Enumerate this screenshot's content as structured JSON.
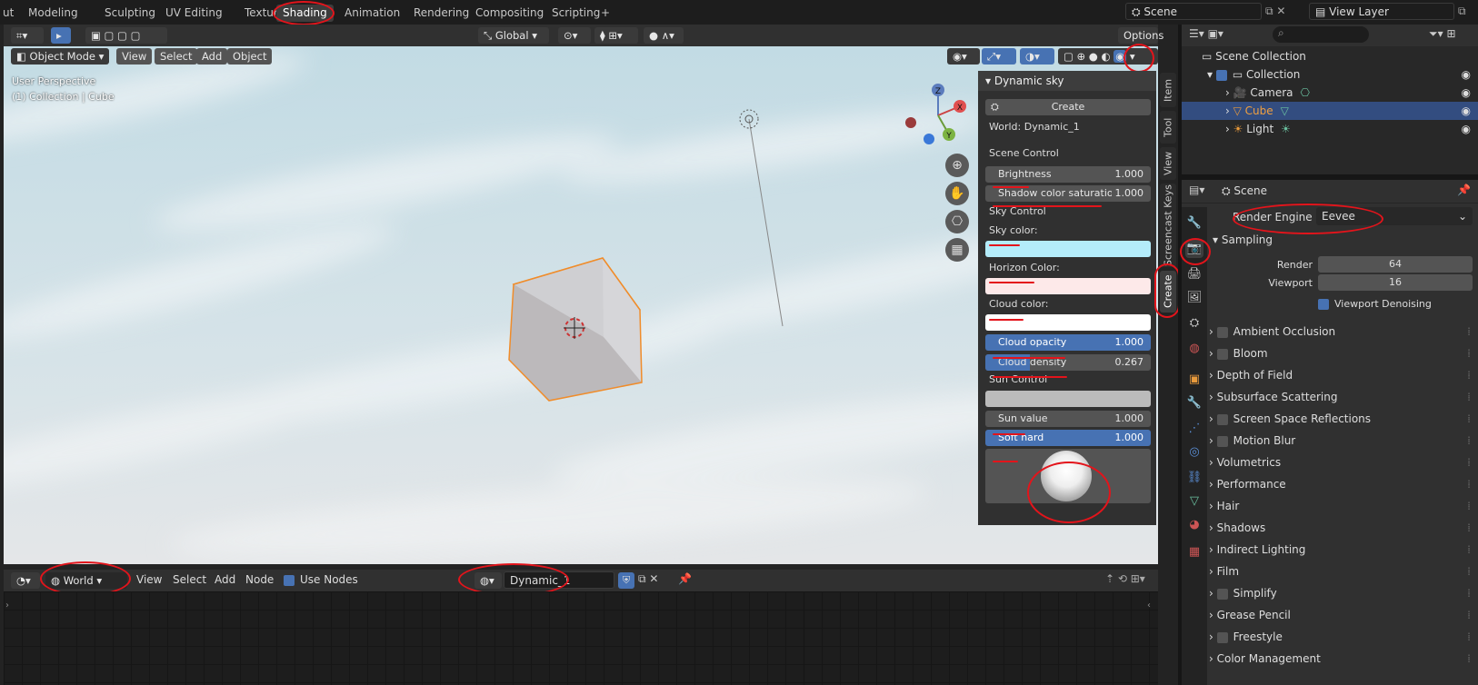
{
  "workspace_tabs": [
    "ut",
    "Modeling",
    "Sculpting",
    "UV Editing",
    "Texture Paint",
    "Shading",
    "Animation",
    "Rendering",
    "Compositing",
    "Scripting",
    "+"
  ],
  "active_tab": "Shading",
  "scene_field": "Scene",
  "view_layer_field": "View Layer",
  "viewport_header": {
    "transform": "Global",
    "options": "Options",
    "mode": "Object Mode",
    "menus": [
      "View",
      "Select",
      "Add",
      "Object"
    ]
  },
  "viewport_info": {
    "line1": "User Perspective",
    "line2": "(1) Collection | Cube"
  },
  "gizmo": {
    "z": "Z",
    "x": "X",
    "y": "Y"
  },
  "npanel": {
    "title": "Dynamic sky",
    "create_button": "Create",
    "world_label": "World: Dynamic_1",
    "scene_control": "Scene Control",
    "brightness": {
      "label": "Brightness",
      "value": "1.000"
    },
    "shadow": {
      "label": "Shadow color saturatio",
      "value": "1.000"
    },
    "sky_control": "Sky Control",
    "sky_color": "Sky color:",
    "horizon_color": "Horizon Color:",
    "cloud_color": "Cloud color:",
    "cloud_opacity": {
      "label": "Cloud opacity",
      "value": "1.000"
    },
    "cloud_density": {
      "label": "Cloud density",
      "value": "0.267"
    },
    "sun_control": "Sun Control",
    "sun_value": {
      "label": "Sun value",
      "value": "1.000"
    },
    "soft_hard": {
      "label": "Soft hard",
      "value": "1.000"
    },
    "sky_swatch": "#b4ecfa",
    "horizon_swatch": "#fde9e9",
    "cloud_swatch": "#ffffff"
  },
  "side_tabs": [
    "Item",
    "Tool",
    "View",
    "Screencast Keys",
    "Create"
  ],
  "node_header": {
    "world": "World",
    "menus": [
      "View",
      "Select",
      "Add",
      "Node"
    ],
    "use_nodes": "Use Nodes",
    "datablock": "Dynamic_1"
  },
  "outliner": {
    "root": "Scene Collection",
    "collection": "Collection",
    "items": [
      "Camera",
      "Cube",
      "Light"
    ]
  },
  "properties": {
    "breadcrumb": "Scene",
    "render_engine_label": "Render Engine",
    "render_engine": "Eevee",
    "sampling": "Sampling",
    "render_label": "Render",
    "render_value": "64",
    "viewport_label": "Viewport",
    "viewport_value": "16",
    "denoise": "Viewport Denoising",
    "sections": [
      {
        "label": "Ambient Occlusion",
        "check": true
      },
      {
        "label": "Bloom",
        "check": true
      },
      {
        "label": "Depth of Field",
        "check": false
      },
      {
        "label": "Subsurface Scattering",
        "check": false
      },
      {
        "label": "Screen Space Reflections",
        "check": true
      },
      {
        "label": "Motion Blur",
        "check": true
      },
      {
        "label": "Volumetrics",
        "check": false
      },
      {
        "label": "Performance",
        "check": false
      },
      {
        "label": "Hair",
        "check": false
      },
      {
        "label": "Shadows",
        "check": false
      },
      {
        "label": "Indirect Lighting",
        "check": false
      },
      {
        "label": "Film",
        "check": false
      },
      {
        "label": "Simplify",
        "check": true
      },
      {
        "label": "Grease Pencil",
        "check": false
      },
      {
        "label": "Freestyle",
        "check": true
      },
      {
        "label": "Color Management",
        "check": false
      }
    ]
  },
  "colors": {
    "accent": "#4772b3",
    "annotation": "#e3141b",
    "selection": "#334d80"
  }
}
